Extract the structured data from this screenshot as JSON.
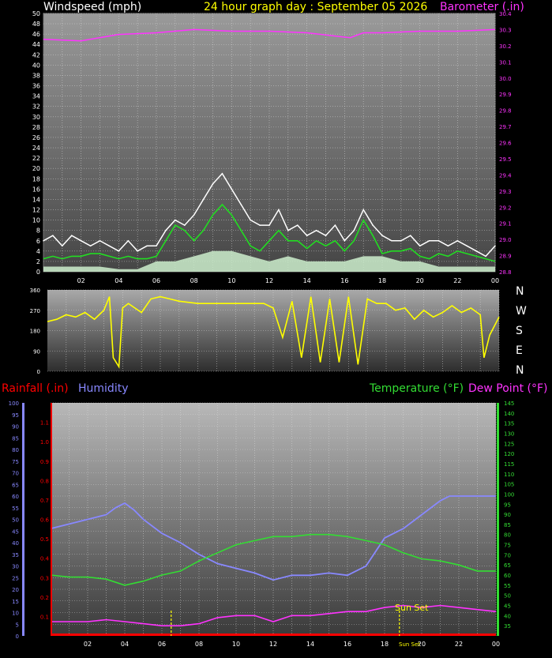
{
  "title": "24 hour graph day : September 05 2026",
  "headers": {
    "windspeed": "Windspeed (mph)",
    "barometer": "Barometer (.in)",
    "rainfall": "Rainfall (.in)",
    "humidity": "Humidity",
    "temperature": "Temperature (°F)",
    "dewpoint": "Dew Point (°F)"
  },
  "colors": {
    "windspeed": "#ffffff",
    "wind_avg": "#22dd22",
    "wind_fill": "#cceecc",
    "barometer": "#ff33ff",
    "direction": "#ffff00",
    "rain": "#ff0000",
    "humidity": "#8888ff",
    "temperature": "#33dd33",
    "dewpoint": "#ff33ff",
    "sun": "#ffff00"
  },
  "x_ticks": [
    "02",
    "04",
    "06",
    "08",
    "10",
    "12",
    "14",
    "16",
    "18",
    "20",
    "22",
    "00"
  ],
  "compass_labels": [
    "N",
    "W",
    "S",
    "E",
    "N"
  ],
  "sun_labels": {
    "sunrise": "Sun Set",
    "sunset": "Sun Set"
  },
  "chart_data": [
    {
      "type": "line",
      "title": "24 hour graph day : September 05 2026",
      "ylabel": "Windspeed (mph)",
      "y2label": "Barometer (.in)",
      "ylim": [
        0,
        50
      ],
      "y2lim": [
        28.8,
        30.4
      ],
      "x_ticks": [
        "02",
        "04",
        "06",
        "08",
        "10",
        "12",
        "14",
        "16",
        "18",
        "20",
        "22",
        "00"
      ],
      "series": [
        {
          "name": "Windspeed (mph)",
          "axis": "left",
          "x": [
            0,
            0.5,
            1,
            1.5,
            2,
            2.5,
            3,
            3.5,
            4,
            4.5,
            5,
            5.5,
            6,
            6.5,
            7,
            7.5,
            8,
            8.5,
            9,
            9.5,
            10,
            10.5,
            11,
            11.5,
            12,
            12.5,
            13,
            13.5,
            14,
            14.5,
            15,
            15.5,
            16,
            16.5,
            17,
            17.5,
            18,
            18.5,
            19,
            19.5,
            20,
            20.5,
            21,
            21.5,
            22,
            22.5,
            23,
            23.5,
            24
          ],
          "values": [
            6,
            7,
            5,
            7,
            6,
            5,
            6,
            5,
            4,
            6,
            4,
            5,
            5,
            8,
            10,
            9,
            11,
            14,
            17,
            19,
            16,
            13,
            10,
            9,
            9,
            12,
            8,
            9,
            7,
            8,
            7,
            9,
            6,
            8,
            12,
            9,
            7,
            6,
            6,
            7,
            5,
            6,
            6,
            5,
            6,
            5,
            4,
            3,
            5
          ]
        },
        {
          "name": "wind average",
          "axis": "left",
          "x": [
            0,
            0.5,
            1,
            1.5,
            2,
            2.5,
            3,
            3.5,
            4,
            4.5,
            5,
            5.5,
            6,
            6.5,
            7,
            7.5,
            8,
            8.5,
            9,
            9.5,
            10,
            10.5,
            11,
            11.5,
            12,
            12.5,
            13,
            13.5,
            14,
            14.5,
            15,
            15.5,
            16,
            16.5,
            17,
            17.5,
            18,
            18.5,
            19,
            19.5,
            20,
            20.5,
            21,
            21.5,
            22,
            22.5,
            23,
            23.5,
            24
          ],
          "values": [
            2.5,
            3,
            2.5,
            3,
            3,
            3.5,
            3.5,
            3,
            2.5,
            3,
            2.5,
            2.5,
            3,
            6,
            9,
            8,
            6,
            8,
            11,
            13,
            11,
            8,
            5,
            4,
            6,
            8,
            6,
            6,
            4.5,
            6,
            5,
            6,
            4,
            6,
            10,
            7,
            3.5,
            4,
            4,
            4.5,
            3,
            2.5,
            3.5,
            3,
            4,
            3.5,
            3,
            2.5,
            2
          ]
        },
        {
          "name": "gust floor",
          "axis": "left",
          "x": [
            0,
            1,
            2,
            3,
            4,
            5,
            6,
            7,
            8,
            9,
            10,
            11,
            12,
            13,
            14,
            15,
            16,
            17,
            18,
            19,
            20,
            21,
            22,
            23,
            24
          ],
          "values": [
            1,
            1,
            1,
            1,
            0.5,
            0.5,
            2,
            2,
            3,
            4,
            4,
            3,
            2,
            3,
            2,
            2,
            2,
            3,
            3,
            2,
            2,
            1,
            1,
            1,
            1
          ]
        },
        {
          "name": "Barometer (.in)",
          "axis": "right",
          "x": [
            0,
            2,
            4,
            6,
            8,
            10,
            12,
            14,
            15.5,
            16.3,
            17,
            18,
            20,
            22,
            24
          ],
          "values": [
            30.24,
            30.23,
            30.27,
            30.28,
            30.3,
            30.29,
            30.29,
            30.28,
            30.26,
            30.25,
            30.28,
            30.28,
            30.29,
            30.29,
            30.3
          ]
        }
      ]
    },
    {
      "type": "line",
      "title": "",
      "ylabel": "",
      "ylim": [
        0,
        360
      ],
      "y_ticks": [
        0,
        90,
        180,
        270,
        360
      ],
      "x_ticks": [
        "02",
        "04",
        "06",
        "08",
        "10",
        "12",
        "14",
        "16",
        "18",
        "20",
        "22",
        "00"
      ],
      "series": [
        {
          "name": "Wind direction",
          "x": [
            0,
            0.5,
            1,
            1.5,
            2,
            2.5,
            3,
            3.3,
            3.5,
            3.8,
            4,
            4.3,
            5,
            5.5,
            6,
            6.5,
            7,
            8,
            9,
            10,
            11,
            11.5,
            12,
            12.5,
            13,
            13.5,
            14,
            14.5,
            15,
            15.5,
            16,
            16.5,
            17,
            17.5,
            18,
            18.5,
            19,
            19.5,
            20,
            20.5,
            21,
            21.5,
            22,
            22.5,
            23,
            23.2,
            23.5,
            24
          ],
          "values": [
            220,
            230,
            250,
            240,
            260,
            230,
            270,
            330,
            60,
            20,
            280,
            300,
            260,
            320,
            330,
            320,
            310,
            300,
            300,
            300,
            300,
            300,
            280,
            150,
            310,
            60,
            330,
            40,
            320,
            40,
            330,
            30,
            320,
            300,
            300,
            270,
            280,
            230,
            270,
            240,
            260,
            290,
            260,
            280,
            250,
            60,
            160,
            240
          ]
        }
      ]
    },
    {
      "type": "line",
      "title": "",
      "ylabel": "Humidity",
      "y2label": "Temperature (°F)",
      "ylim": [
        0,
        100
      ],
      "y2lim": [
        30,
        145
      ],
      "rain_ylim": [
        0,
        1.2
      ],
      "x_ticks": [
        "02",
        "04",
        "06",
        "08",
        "10",
        "12",
        "14",
        "16",
        "18",
        "20",
        "22",
        "00"
      ],
      "series": [
        {
          "name": "Humidity",
          "axis": "left",
          "x": [
            0,
            1,
            2,
            3,
            3.5,
            4,
            4.5,
            5,
            6,
            7,
            8,
            9,
            10,
            11,
            12,
            13,
            14,
            15,
            16,
            17,
            18,
            19,
            20,
            21,
            21.5,
            22,
            23,
            24
          ],
          "values": [
            46,
            48,
            50,
            52,
            55,
            57,
            54,
            50,
            44,
            40,
            35,
            31,
            29,
            27,
            24,
            26,
            26,
            27,
            26,
            30,
            42,
            46,
            52,
            58,
            60,
            60,
            60,
            60
          ]
        },
        {
          "name": "Temperature (°F)",
          "axis": "right",
          "x": [
            0,
            1,
            2,
            3,
            4,
            5,
            6,
            7,
            8,
            9,
            10,
            11,
            12,
            13,
            14,
            15,
            16,
            17,
            18,
            19,
            20,
            21,
            22,
            23,
            24
          ],
          "values": [
            60,
            59,
            59,
            58,
            55,
            57,
            60,
            62,
            67,
            71,
            75,
            77,
            79,
            79,
            80,
            80,
            79,
            77,
            75,
            71,
            68,
            67,
            65,
            62,
            62
          ]
        },
        {
          "name": "Dew Point (°F)",
          "axis": "right",
          "x": [
            0,
            1,
            2,
            3,
            4,
            5,
            6,
            7,
            8,
            9,
            10,
            11,
            12,
            13,
            14,
            15,
            16,
            17,
            18,
            19,
            20,
            21,
            22,
            23,
            24
          ],
          "values": [
            37,
            37,
            37,
            38,
            37,
            36,
            35,
            35,
            36,
            39,
            40,
            40,
            37,
            40,
            40,
            41,
            42,
            42,
            44,
            45,
            44,
            45,
            44,
            43,
            42
          ]
        },
        {
          "name": "Rainfall (.in)",
          "axis": "rain",
          "x": [
            0,
            24
          ],
          "values": [
            0,
            0
          ]
        }
      ],
      "sun_markers": [
        6.5,
        18.8
      ]
    }
  ]
}
